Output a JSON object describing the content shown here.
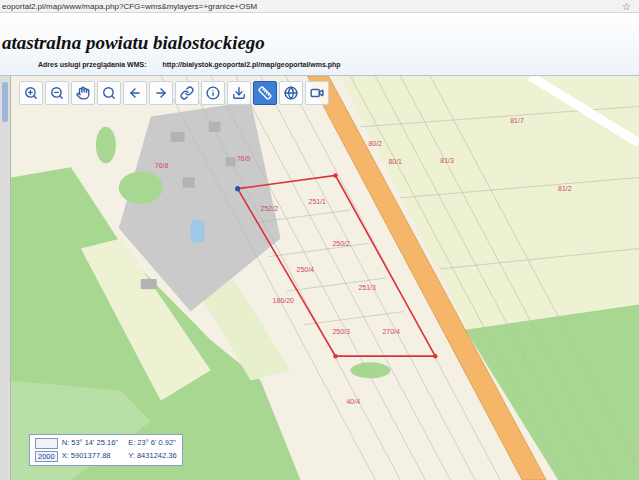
{
  "browser": {
    "url": "eoportal2.pl/map/www/mapa.php?CFG=wms&mylayers=+granice+OSM",
    "star": "☆"
  },
  "header": {
    "title": "atastralna powiatu bialostockiego",
    "address_label": "Adres usługi przeglądania WMS:",
    "address_url": "http://bialystok.geoportal2.pl/map/geoportal/wms.php"
  },
  "toolbar": [
    {
      "selected": false
    },
    {
      "selected": false
    },
    {
      "selected": false
    },
    {
      "selected": false
    },
    {
      "selected": false
    },
    {
      "selected": false
    },
    {
      "selected": false
    },
    {
      "selected": false
    },
    {
      "selected": false
    },
    {
      "selected": true
    },
    {
      "selected": false
    },
    {
      "selected": false
    }
  ],
  "map": {
    "parcels": [
      "251/1",
      "252/2",
      "250/2",
      "250/4",
      "251/3",
      "186/20",
      "250/3",
      "270/4",
      "80/2",
      "80/1",
      "81/7",
      "81/3",
      "81/2",
      "76/9",
      "76/8",
      "40/4"
    ]
  },
  "coordinates": {
    "scale": "2000",
    "n": "N: 53° 14' 25.16''",
    "e": "E: 23° 6' 0.92''",
    "x": "X: 5901377.88",
    "y": "Y: 8431242.36"
  }
}
